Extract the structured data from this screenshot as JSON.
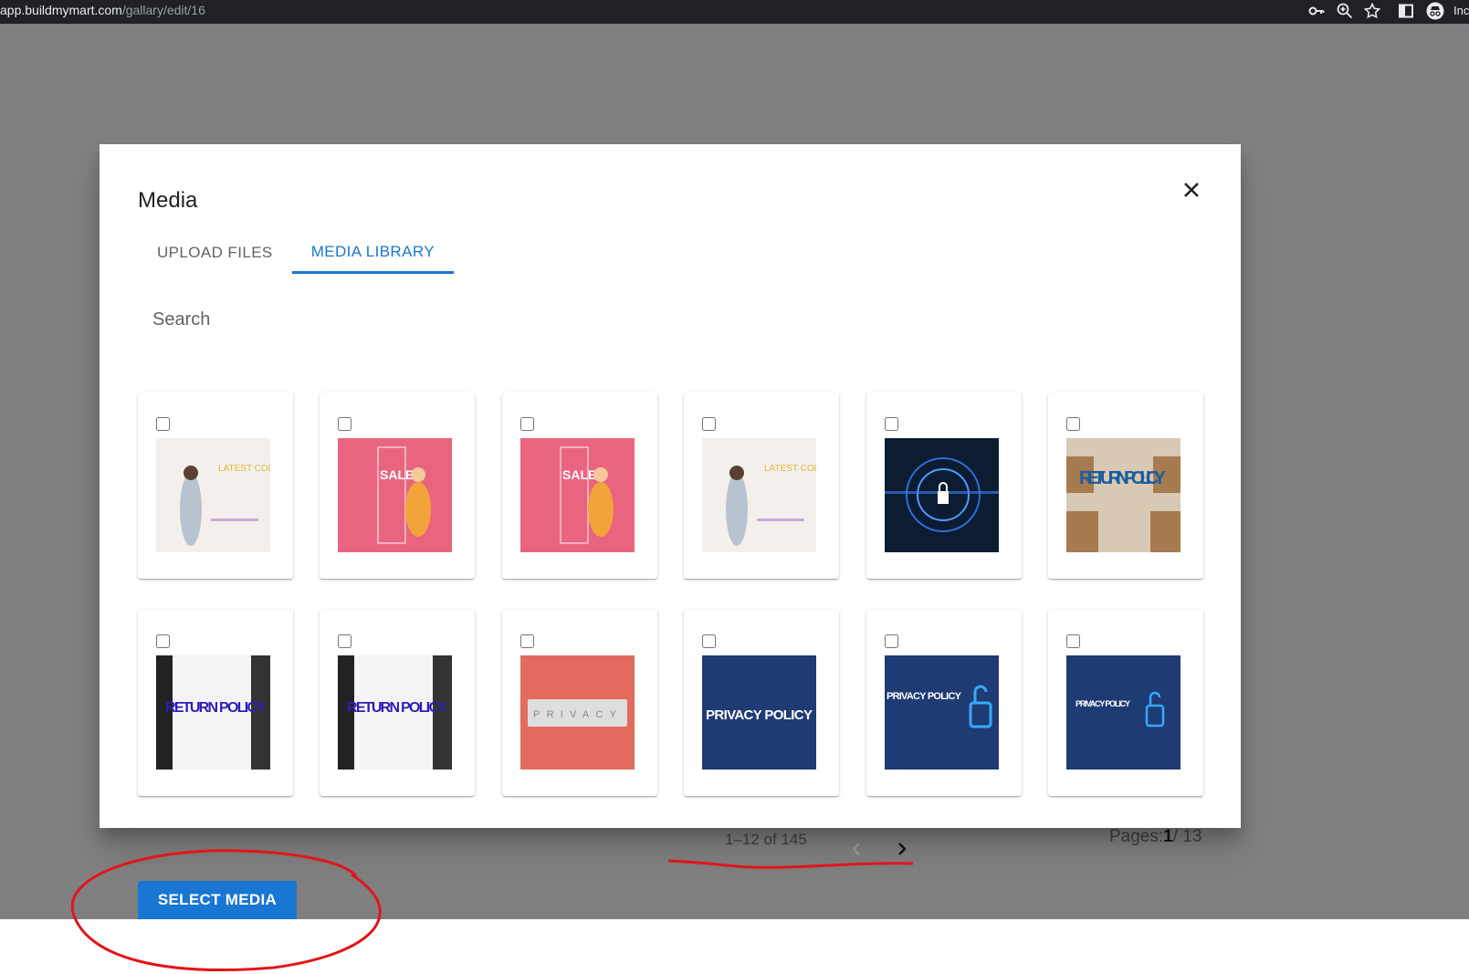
{
  "browser": {
    "url_host": "app.buildmymart.com",
    "url_path": "/gallary/edit/16",
    "profile_label": "Inc",
    "icons": [
      "key-icon",
      "zoom-icon",
      "star-icon",
      "sidebar-icon",
      "incognito-icon"
    ]
  },
  "modal": {
    "title": "Media",
    "tabs": [
      {
        "label": "UPLOAD FILES",
        "active": false
      },
      {
        "label": "MEDIA LIBRARY",
        "active": true
      }
    ],
    "search_placeholder": "Search",
    "media_items": [
      {
        "thumbnail": "latest-collection-banner",
        "thumb_text": "LATEST COLLECTION",
        "selected": false
      },
      {
        "thumbnail": "pink-sale-banner",
        "thumb_text": "SALE",
        "selected": false
      },
      {
        "thumbnail": "pink-sale-banner",
        "thumb_text": "SALE",
        "selected": false
      },
      {
        "thumbnail": "latest-collection-banner",
        "thumb_text": "LATEST COLLECTION",
        "selected": false
      },
      {
        "thumbnail": "digital-lock-security",
        "thumb_text": "",
        "selected": false
      },
      {
        "thumbnail": "return-policy-boxes",
        "thumb_text": "RETURN POLICY",
        "selected": false
      },
      {
        "thumbnail": "return-policy-keyboard",
        "thumb_text": "RETURN POLICY",
        "selected": false
      },
      {
        "thumbnail": "return-policy-keyboard",
        "thumb_text": "RETURN POLICY",
        "selected": false
      },
      {
        "thumbnail": "privacy-tiles-red",
        "thumb_text": "PRIVACY",
        "selected": false
      },
      {
        "thumbnail": "privacy-policy-blue",
        "thumb_text": "PRIVACY POLICY",
        "selected": false
      },
      {
        "thumbnail": "privacy-policy-lock-blue",
        "thumb_text": "PRIVACY POLICY",
        "selected": false
      },
      {
        "thumbnail": "privacy-policy-lock-blue-small",
        "thumb_text": "PRIVACY POLICY",
        "selected": false
      }
    ]
  },
  "pagination": {
    "range_text": "1–12 of 145",
    "pages_label": "Pages:",
    "current_page": "1",
    "total_pages": "/ 13",
    "prev_enabled": false,
    "next_enabled": true
  },
  "actions": {
    "select_media_label": "SELECT MEDIA"
  },
  "colors": {
    "accent": "#1976d2",
    "overlay": "#808080",
    "annotation_red": "#e0161b"
  }
}
